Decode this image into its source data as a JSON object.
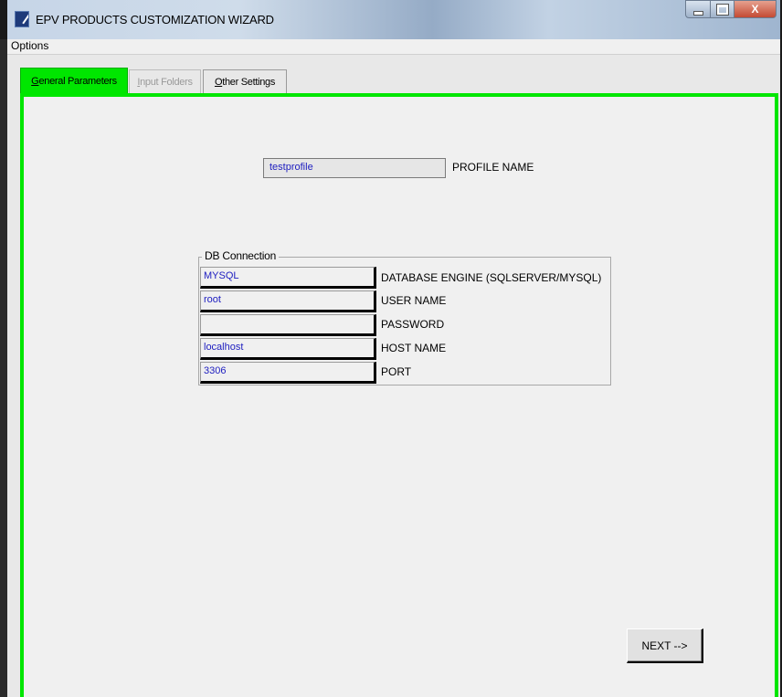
{
  "window": {
    "title": "EPV PRODUCTS CUSTOMIZATION WIZARD",
    "icon": "app-wrench-icon",
    "controls": {
      "minimize_icon": "minimize-icon",
      "maximize_icon": "maximize-icon",
      "close_label": "X"
    }
  },
  "menu": {
    "options_label": "Options"
  },
  "tabs": [
    {
      "first": "G",
      "rest": "eneral Parameters",
      "state": "active"
    },
    {
      "first": "I",
      "rest": "nput Folders",
      "state": "disabled"
    },
    {
      "first": "O",
      "rest": "ther Settings",
      "state": "normal"
    }
  ],
  "colors": {
    "tab_active": "#00e600",
    "field_text": "#2020c0"
  },
  "profile": {
    "value": "testprofile",
    "label": "PROFILE NAME"
  },
  "db_connection": {
    "legend": "DB Connection",
    "fields": [
      {
        "value": "MYSQL",
        "label": "DATABASE ENGINE (SQLSERVER/MYSQL)"
      },
      {
        "value": "root",
        "label": "USER NAME"
      },
      {
        "value": "",
        "label": "PASSWORD"
      },
      {
        "value": "localhost",
        "label": "HOST NAME"
      },
      {
        "value": "3306",
        "label": "PORT"
      }
    ]
  },
  "next_button": {
    "label": "NEXT -->"
  }
}
